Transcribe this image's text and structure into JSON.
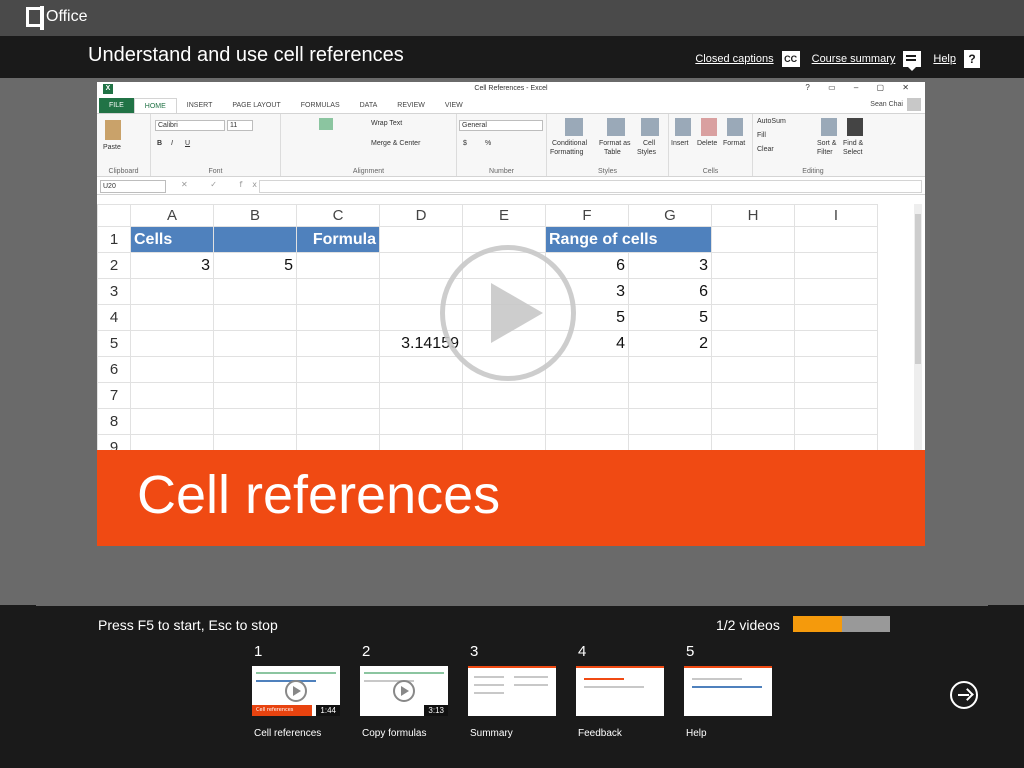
{
  "app": {
    "name": "Office"
  },
  "course": {
    "title": "Understand and use cell references"
  },
  "toplinks": {
    "captions": "Closed captions",
    "captions_icon": "CC",
    "summary": "Course summary",
    "help": "Help",
    "help_icon": "?"
  },
  "excel": {
    "doc_title": "Cell References - Excel",
    "logo": "X",
    "window_buttons": "? ▭ – ▢ ✕",
    "tabs": [
      "FILE",
      "HOME",
      "INSERT",
      "PAGE LAYOUT",
      "FORMULAS",
      "DATA",
      "REVIEW",
      "VIEW"
    ],
    "user": "Sean Chai",
    "ribbon": {
      "paste": "Paste",
      "font_name": "Calibri",
      "font_size": "11",
      "bold": "B",
      "italic": "I",
      "underline": "U",
      "wrap_text": "Wrap Text",
      "merge_center": "Merge & Center",
      "number_format": "General",
      "currency": "$",
      "percent": "%",
      "conditional": "Conditional",
      "formatting": "Formatting",
      "format_as": "Format as",
      "table": "Table",
      "cell": "Cell",
      "styles_btn": "Styles",
      "insert": "Insert",
      "delete": "Delete",
      "format": "Format",
      "autosum": "AutoSum",
      "fill": "Fill",
      "clear": "Clear",
      "sort1": "Sort &",
      "sort2": "Filter",
      "find1": "Find &",
      "find2": "Select",
      "groups": [
        "Clipboard",
        "Font",
        "Alignment",
        "Number",
        "Styles",
        "Cells",
        "Editing"
      ]
    },
    "namebox": "U20",
    "formula_icons": "✕ ✓ fx",
    "columns": [
      "A",
      "B",
      "C",
      "D",
      "E",
      "F",
      "G",
      "H",
      "I"
    ],
    "rows": [
      "1",
      "2",
      "3",
      "4",
      "5",
      "6",
      "7",
      "8",
      "9"
    ],
    "cells": {
      "A1": "Cells",
      "C1": "Formula",
      "F1": "Range of cells",
      "A2": "3",
      "B2": "5",
      "F2": "6",
      "G2": "3",
      "F3": "3",
      "G3": "6",
      "F4": "5",
      "G4": "5",
      "D5": "3.14159",
      "F5": "4",
      "G5": "2"
    }
  },
  "banner": {
    "text": "Cell references"
  },
  "bottom": {
    "press": "Press F5 to start, Esc to stop",
    "video_count": "1/2 videos",
    "progress": 0.5,
    "thumbs": [
      {
        "num": "1",
        "label": "Cell references",
        "duration": "1:44",
        "caption": "Cell references"
      },
      {
        "num": "2",
        "label": "Copy formulas",
        "duration": "3:13"
      },
      {
        "num": "3",
        "label": "Summary"
      },
      {
        "num": "4",
        "label": "Feedback"
      },
      {
        "num": "5",
        "label": "Help"
      }
    ]
  },
  "colors": {
    "accent": "#f04a13",
    "excel_green": "#217346",
    "header_blue": "#4f81bd",
    "progress": "#f59a0c"
  }
}
